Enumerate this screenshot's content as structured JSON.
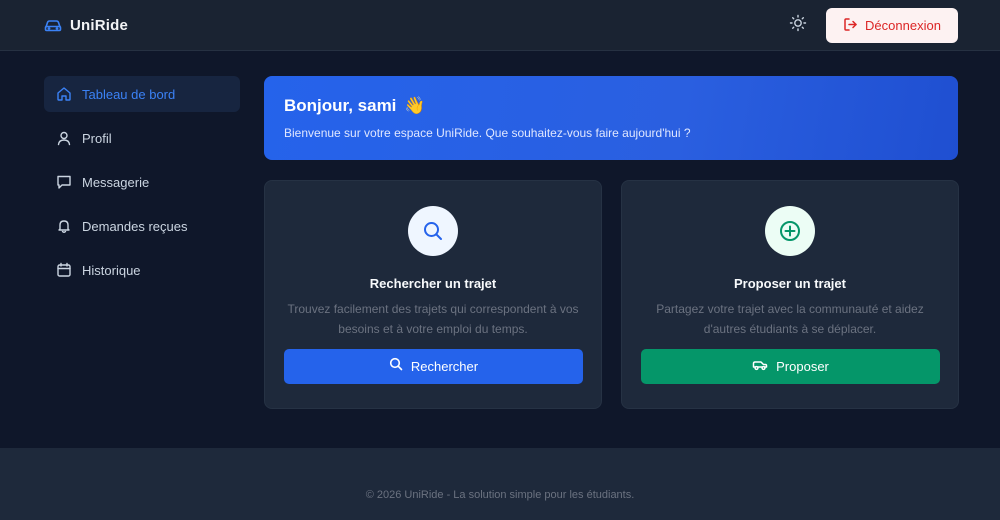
{
  "header": {
    "brand": "UniRide",
    "logout_label": "Déconnexion",
    "brand_icon": "car-icon",
    "theme_icon": "sun-icon",
    "logout_icon": "logout-icon"
  },
  "sidebar": {
    "items": [
      {
        "label": "Tableau de bord",
        "icon": "home-icon",
        "active": true
      },
      {
        "label": "Profil",
        "icon": "user-icon",
        "active": false
      },
      {
        "label": "Messagerie",
        "icon": "message-icon",
        "active": false
      },
      {
        "label": "Demandes reçues",
        "icon": "bell-icon",
        "active": false
      },
      {
        "label": "Historique",
        "icon": "calendar-icon",
        "active": false
      }
    ]
  },
  "banner": {
    "title": "Bonjour, sami",
    "emoji": "👋",
    "subtitle": "Bienvenue sur votre espace UniRide. Que souhaitez-vous faire aujourd'hui ?"
  },
  "cards": {
    "search": {
      "title": "Rechercher un trajet",
      "description": "Trouvez facilement des trajets qui correspondent à vos besoins et à votre emploi du temps.",
      "button_label": "Rechercher",
      "icon": "search-icon"
    },
    "propose": {
      "title": "Proposer un trajet",
      "description": "Partagez votre trajet avec la communauté et aidez d'autres étudiants à se déplacer.",
      "button_label": "Proposer",
      "icon": "plus-circle-icon"
    }
  },
  "footer": {
    "text": "© 2026 UniRide - La solution simple pour les étudiants."
  },
  "colors": {
    "background": "#0f172a",
    "primary": "#2563eb",
    "success": "#059669",
    "danger": "#dc2626"
  }
}
